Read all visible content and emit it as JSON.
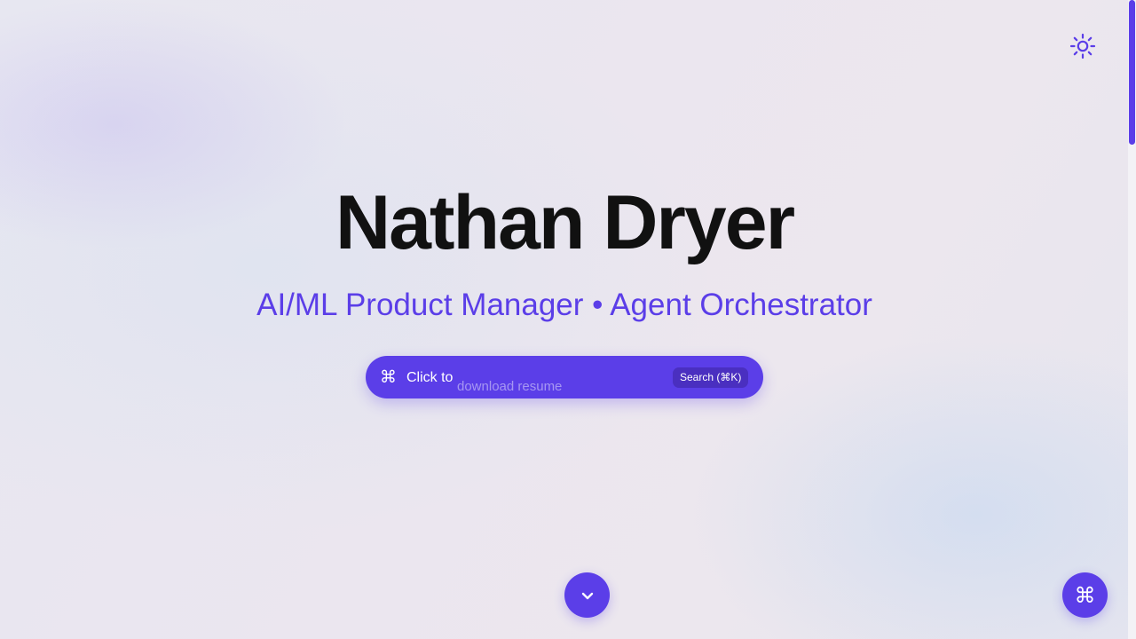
{
  "hero": {
    "name": "Nathan Dryer",
    "subtitle": "AI/ML Product Manager • Agent Orchestrator"
  },
  "search": {
    "icon": "command-icon",
    "glyph": "⌘",
    "label": "Click to",
    "rotating_text": "download resume",
    "shortcut": "Search (⌘K)"
  },
  "controls": {
    "theme_toggle_icon": "sun-icon",
    "scroll_down_icon": "chevron-down-icon",
    "command_palette_icon": "command-icon",
    "command_palette_glyph": "⌘"
  },
  "colors": {
    "accent": "#5b3ee8",
    "text": "#111111"
  }
}
